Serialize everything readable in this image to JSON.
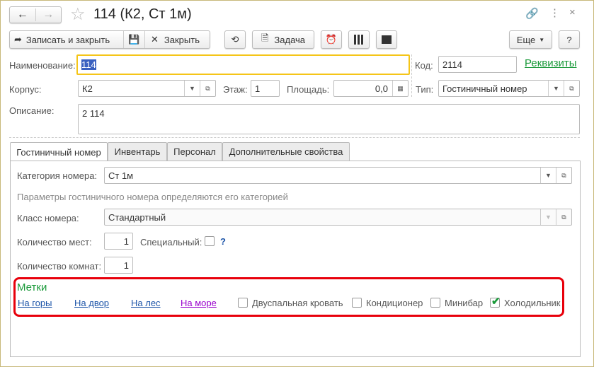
{
  "window": {
    "title": "114 (К2, Ст 1м)"
  },
  "toolbar": {
    "save_close": "Записать и закрыть",
    "close": "Закрыть",
    "task": "Задача",
    "more": "Еще",
    "help": "?"
  },
  "form": {
    "name_label": "Наименование:",
    "name_value": "114",
    "code_label": "Код:",
    "code_value": "2114",
    "details_link": "Реквизиты",
    "building_label": "Корпус:",
    "building_value": "К2",
    "floor_label": "Этаж:",
    "floor_value": "1",
    "area_label": "Площадь:",
    "area_value": "0,0",
    "type_label": "Тип:",
    "type_value": "Гостиничный номер",
    "desc_label": "Описание:",
    "desc_value": "2 114"
  },
  "tabs": [
    {
      "label": "Гостиничный номер"
    },
    {
      "label": "Инвентарь"
    },
    {
      "label": "Персонал"
    },
    {
      "label": "Дополнительные свойства"
    }
  ],
  "room": {
    "category_label": "Категория номера:",
    "category_value": "Ст 1м",
    "hint": "Параметры гостиничного номера определяются его категорией",
    "class_label": "Класс номера:",
    "class_value": "Стандартный",
    "seats_label": "Количество мест:",
    "seats_value": "1",
    "special_label": "Специальный:",
    "special_help": "?",
    "rooms_label": "Количество комнат:",
    "rooms_value": "1"
  },
  "tags": {
    "title": "Метки",
    "links": [
      {
        "label": "На горы"
      },
      {
        "label": "На двор"
      },
      {
        "label": "На лес"
      },
      {
        "label": "На море"
      }
    ],
    "checkboxes": [
      {
        "label": "Двуспальная кровать",
        "checked": false
      },
      {
        "label": "Кондиционер",
        "checked": false
      },
      {
        "label": "Минибар",
        "checked": false
      },
      {
        "label": "Холодильник",
        "checked": true
      }
    ]
  }
}
